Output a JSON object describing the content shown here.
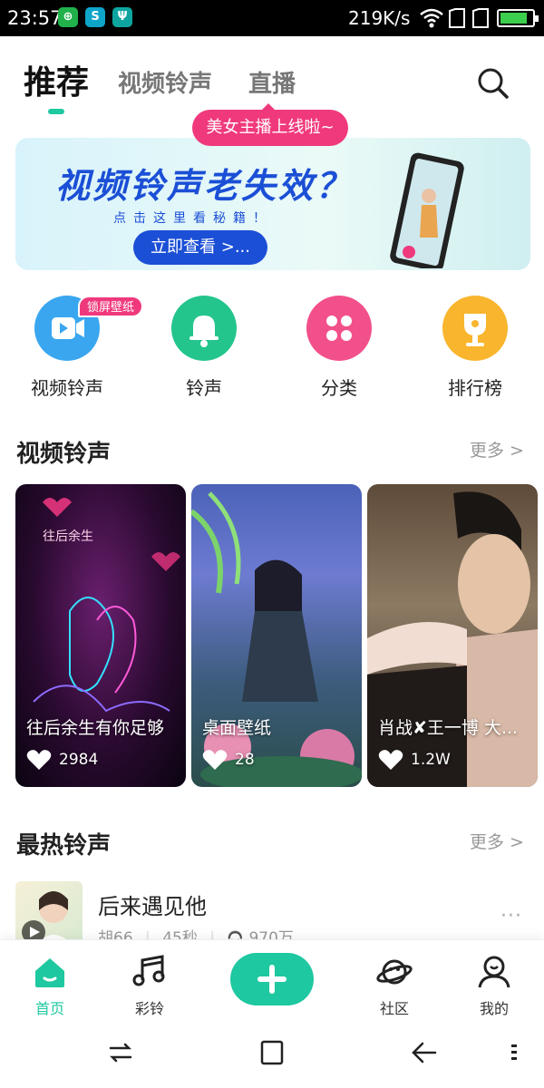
{
  "status_bar": {
    "time": "23:57",
    "network_speed": "219K/s",
    "battery_level": 0.85,
    "icons": [
      "green-app-icon",
      "blue-app-icon",
      "usb-icon",
      "wifi-icon",
      "sim1-icon",
      "sim2-icon",
      "battery-icon"
    ]
  },
  "header": {
    "tabs": [
      {
        "label": "推荐",
        "active": true
      },
      {
        "label": "视频铃声",
        "active": false
      },
      {
        "label": "直播",
        "active": false
      }
    ],
    "search_icon": "search-icon",
    "live_bubble": "美女主播上线啦~"
  },
  "banner": {
    "title": "视频铃声老失效？",
    "subtitle": "点击这里看秘籍！",
    "cta": "立即查看 >..."
  },
  "categories": [
    {
      "label": "视频铃声",
      "icon": "video-icon",
      "color": "#3aa6ef",
      "badge": "锁屏壁纸"
    },
    {
      "label": "铃声",
      "icon": "bell-icon",
      "color": "#23c58c"
    },
    {
      "label": "分类",
      "icon": "grid-icon",
      "color": "#f2508a"
    },
    {
      "label": "排行榜",
      "icon": "trophy-icon",
      "color": "#f8b52d"
    }
  ],
  "video_section": {
    "title": "视频铃声",
    "more": "更多 >",
    "cards": [
      {
        "caption": "往后余生有你足够",
        "likes": "2984"
      },
      {
        "caption": "桌面壁纸",
        "likes": "28"
      },
      {
        "caption": "肖战✘王一博   大...",
        "likes": "1.2W"
      }
    ]
  },
  "hot_section": {
    "title": "最热铃声",
    "more": "更多 >",
    "songs": [
      {
        "title": "后来遇见他",
        "artist": "胡66",
        "duration": "45秒",
        "plays": "970万"
      }
    ]
  },
  "bottom_nav": [
    {
      "label": "首页",
      "icon": "home-icon",
      "active": true
    },
    {
      "label": "彩铃",
      "icon": "music-note-icon",
      "active": false
    },
    {
      "label": "社区",
      "icon": "planet-icon",
      "active": false
    },
    {
      "label": "我的",
      "icon": "profile-icon",
      "active": false
    }
  ],
  "accent_color": "#1ec8a0"
}
